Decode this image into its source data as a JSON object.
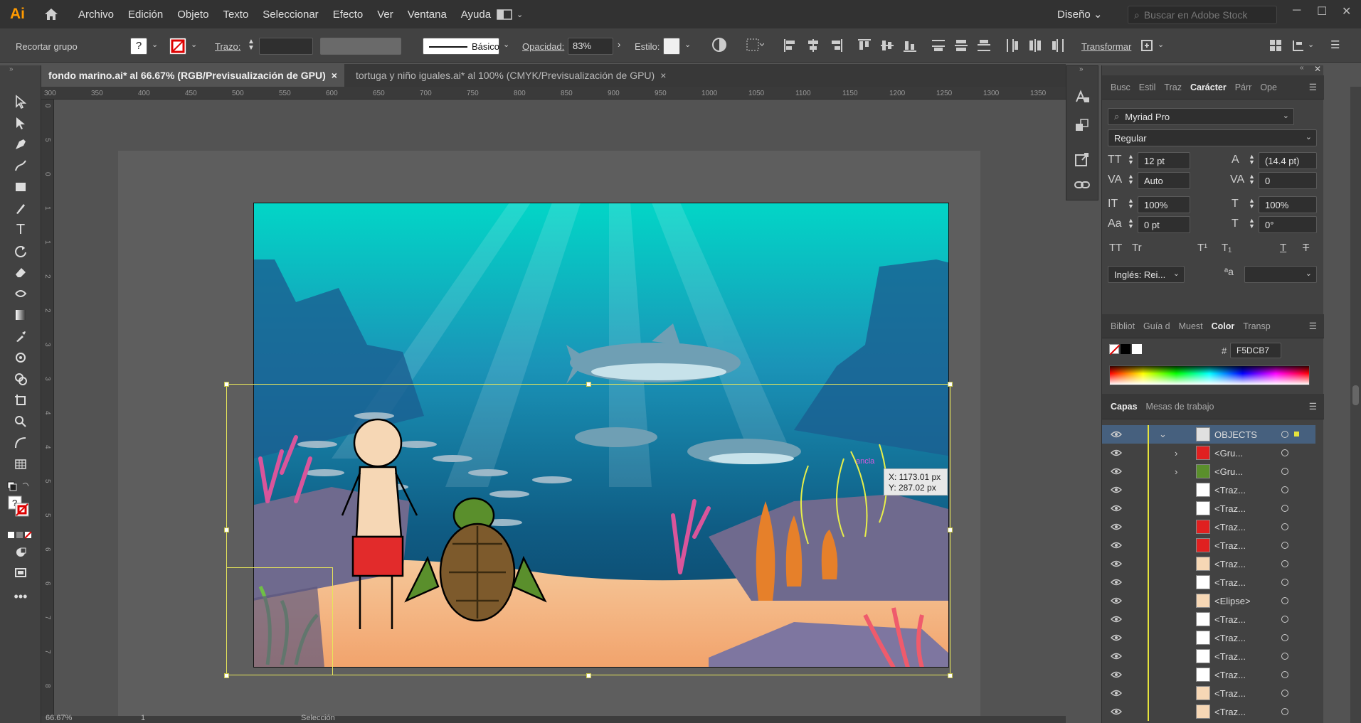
{
  "menubar": {
    "logo": "Ai",
    "items": [
      "Archivo",
      "Edición",
      "Objeto",
      "Texto",
      "Seleccionar",
      "Efecto",
      "Ver",
      "Ventana",
      "Ayuda"
    ],
    "workspace": "Diseño",
    "search_placeholder": "Buscar en Adobe Stock"
  },
  "controlbar": {
    "context": "Recortar grupo",
    "fill_unknown": "?",
    "stroke_label": "Trazo:",
    "brush_label": "Básico",
    "opacity_label": "Opacidad:",
    "opacity_value": "83%",
    "style_label": "Estilo:",
    "transform_label": "Transformar"
  },
  "tabs": [
    {
      "label": "fondo marino.ai* al 66.67% (RGB/Previsualización de GPU)",
      "close": "×"
    },
    {
      "label": "tortuga y niño iguales.ai* al 100% (CMYK/Previsualización de GPU)",
      "close": "×"
    }
  ],
  "ruler_h": [
    "300",
    "350",
    "400",
    "450",
    "500",
    "550",
    "600",
    "650",
    "700",
    "750",
    "800",
    "850",
    "900",
    "950",
    "1000",
    "1050",
    "1100",
    "1150",
    "1200",
    "1250",
    "1300",
    "1350"
  ],
  "ruler_v": [
    "0",
    "5",
    "0",
    "1",
    "1",
    "2",
    "2",
    "3",
    "3",
    "4",
    "4",
    "5",
    "5",
    "6",
    "6",
    "7",
    "7",
    "8"
  ],
  "canvas": {
    "readout_x": "X: 1173.01 px",
    "readout_y": "Y: 287.02 px",
    "anchor_label": "ancla"
  },
  "status": {
    "zoom": "66.67%",
    "page": "1",
    "mode": "Selección"
  },
  "panels": {
    "top_tabs": [
      "Busc",
      "Estil",
      "Traz",
      "Carácter",
      "Párr",
      "Ope"
    ],
    "font_family": "Myriad Pro",
    "font_style": "Regular",
    "font_size": "12 pt",
    "leading": "(14.4 pt)",
    "kerning": "Auto",
    "tracking": "0",
    "vscale": "100%",
    "hscale": "100%",
    "baseline": "0 pt",
    "rotation": "0°",
    "language": "Inglés: Rei...",
    "color_tabs": [
      "Bibliot",
      "Guía d",
      "Muest",
      "Color",
      "Transp"
    ],
    "hex_label": "#",
    "hex_value": "F5DCB7",
    "layers_tabs": [
      "Capas",
      "Mesas de trabajo"
    ]
  },
  "layers": [
    {
      "name": "OBJECTS",
      "expand": "⌄",
      "selected": true
    },
    {
      "name": "<Gru...",
      "expand": "›"
    },
    {
      "name": "<Gru...",
      "expand": "›"
    },
    {
      "name": "<Traz...",
      "expand": ""
    },
    {
      "name": "<Traz...",
      "expand": ""
    },
    {
      "name": "<Traz...",
      "expand": ""
    },
    {
      "name": "<Traz...",
      "expand": ""
    },
    {
      "name": "<Traz...",
      "expand": ""
    },
    {
      "name": "<Traz...",
      "expand": ""
    },
    {
      "name": "<Elipse>",
      "expand": ""
    },
    {
      "name": "<Traz...",
      "expand": ""
    },
    {
      "name": "<Traz...",
      "expand": ""
    },
    {
      "name": "<Traz...",
      "expand": ""
    },
    {
      "name": "<Traz...",
      "expand": ""
    },
    {
      "name": "<Traz...",
      "expand": ""
    },
    {
      "name": "<Traz...",
      "expand": ""
    }
  ],
  "colors": {
    "accent_orange": "#ff9a00",
    "selection_yellow": "#e7e55a",
    "hex_fill": "#F5DCB7"
  }
}
